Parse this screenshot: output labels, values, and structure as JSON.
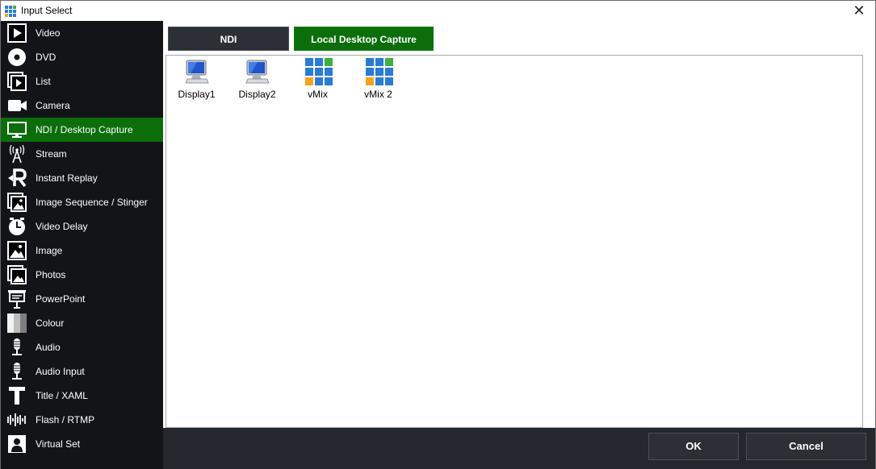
{
  "window": {
    "title": "Input Select"
  },
  "sidebar": {
    "items": [
      {
        "label": "Video",
        "icon": "video-icon"
      },
      {
        "label": "DVD",
        "icon": "dvd-icon"
      },
      {
        "label": "List",
        "icon": "list-icon"
      },
      {
        "label": "Camera",
        "icon": "camera-icon"
      },
      {
        "label": "NDI / Desktop Capture",
        "icon": "monitor-icon",
        "active": true
      },
      {
        "label": "Stream",
        "icon": "antenna-icon"
      },
      {
        "label": "Instant Replay",
        "icon": "replay-icon"
      },
      {
        "label": "Image Sequence / Stinger",
        "icon": "image-sequence-icon"
      },
      {
        "label": "Video Delay",
        "icon": "clock-icon"
      },
      {
        "label": "Image",
        "icon": "image-icon"
      },
      {
        "label": "Photos",
        "icon": "photos-icon"
      },
      {
        "label": "PowerPoint",
        "icon": "presentation-icon"
      },
      {
        "label": "Colour",
        "icon": "colour-icon"
      },
      {
        "label": "Audio",
        "icon": "microphone-icon"
      },
      {
        "label": "Audio Input",
        "icon": "microphone-icon"
      },
      {
        "label": "Title / XAML",
        "icon": "title-icon"
      },
      {
        "label": "Flash / RTMP",
        "icon": "waveform-icon"
      },
      {
        "label": "Virtual Set",
        "icon": "person-icon"
      }
    ]
  },
  "tabs": {
    "ndi": "NDI",
    "local": "Local Desktop Capture",
    "active": "local"
  },
  "sources": [
    {
      "label": "Display1",
      "icon": "computer-icon"
    },
    {
      "label": "Display2",
      "icon": "computer-icon"
    },
    {
      "label": "vMix",
      "icon": "vmix-icon"
    },
    {
      "label": "vMix 2",
      "icon": "vmix-icon"
    }
  ],
  "footer": {
    "ok_label": "OK",
    "cancel_label": "Cancel"
  },
  "colors": {
    "accent_green": "#0b6e0b",
    "sidebar_bg": "#121418",
    "footer_bg": "#24272d",
    "vmix_blue": "#2a7bd4",
    "vmix_green": "#3cb043",
    "vmix_orange": "#f3a21b"
  }
}
